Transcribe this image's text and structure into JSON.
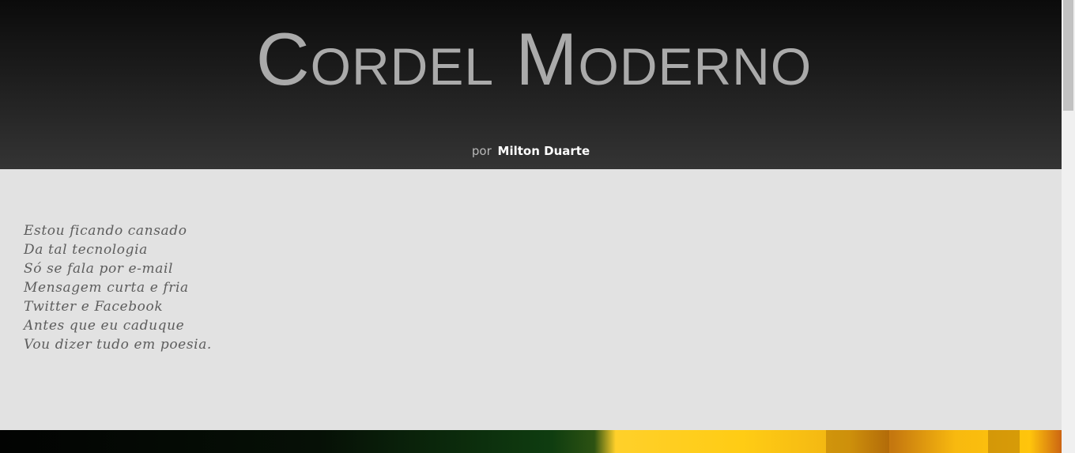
{
  "header": {
    "title": "Cordel Moderno",
    "byline_prefix": "por",
    "author": "Milton Duarte"
  },
  "poem": {
    "lines": [
      "Estou ficando cansado",
      "Da tal tecnologia",
      "Só se fala por e-mail",
      "Mensagem curta e fria",
      "Twitter e Facebook",
      "Antes que eu caduque",
      "Vou dizer tudo em poesia."
    ]
  },
  "colors": {
    "header_top": "#0b0b0b",
    "header_bottom": "#343434",
    "title": "#aaaaaa",
    "content_bg": "#e2e2e2",
    "poem_text": "#5d5d5d"
  },
  "scrollbar": {
    "position_fraction": 0
  }
}
